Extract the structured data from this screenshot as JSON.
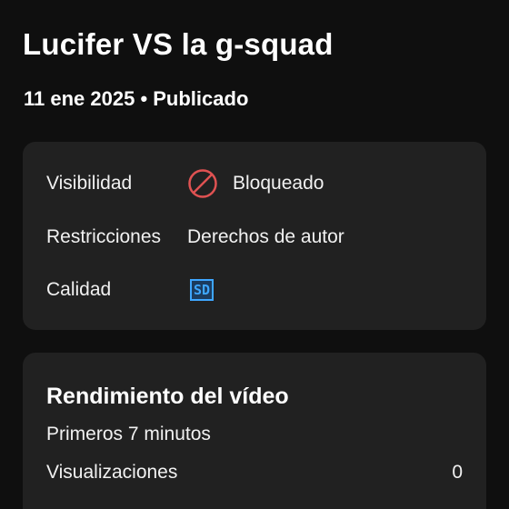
{
  "video": {
    "title": "Lucifer VS la g-squad",
    "meta": "11 ene 2025 • Publicado"
  },
  "status_card": {
    "visibility_label": "Visibilidad",
    "visibility_value": "Bloqueado",
    "visibility_icon": "blocked-icon",
    "restrictions_label": "Restricciones",
    "restrictions_value": "Derechos de autor",
    "quality_label": "Calidad",
    "quality_badge": "SD"
  },
  "performance_card": {
    "title": "Rendimiento del vídeo",
    "period": "Primeros 7 minutos",
    "metrics": [
      {
        "label": "Visualizaciones",
        "value": "0"
      }
    ]
  },
  "colors": {
    "background": "#0f0f0f",
    "card": "#212121",
    "blocked_red": "#e05252",
    "sd_blue": "#3ea6ff"
  }
}
